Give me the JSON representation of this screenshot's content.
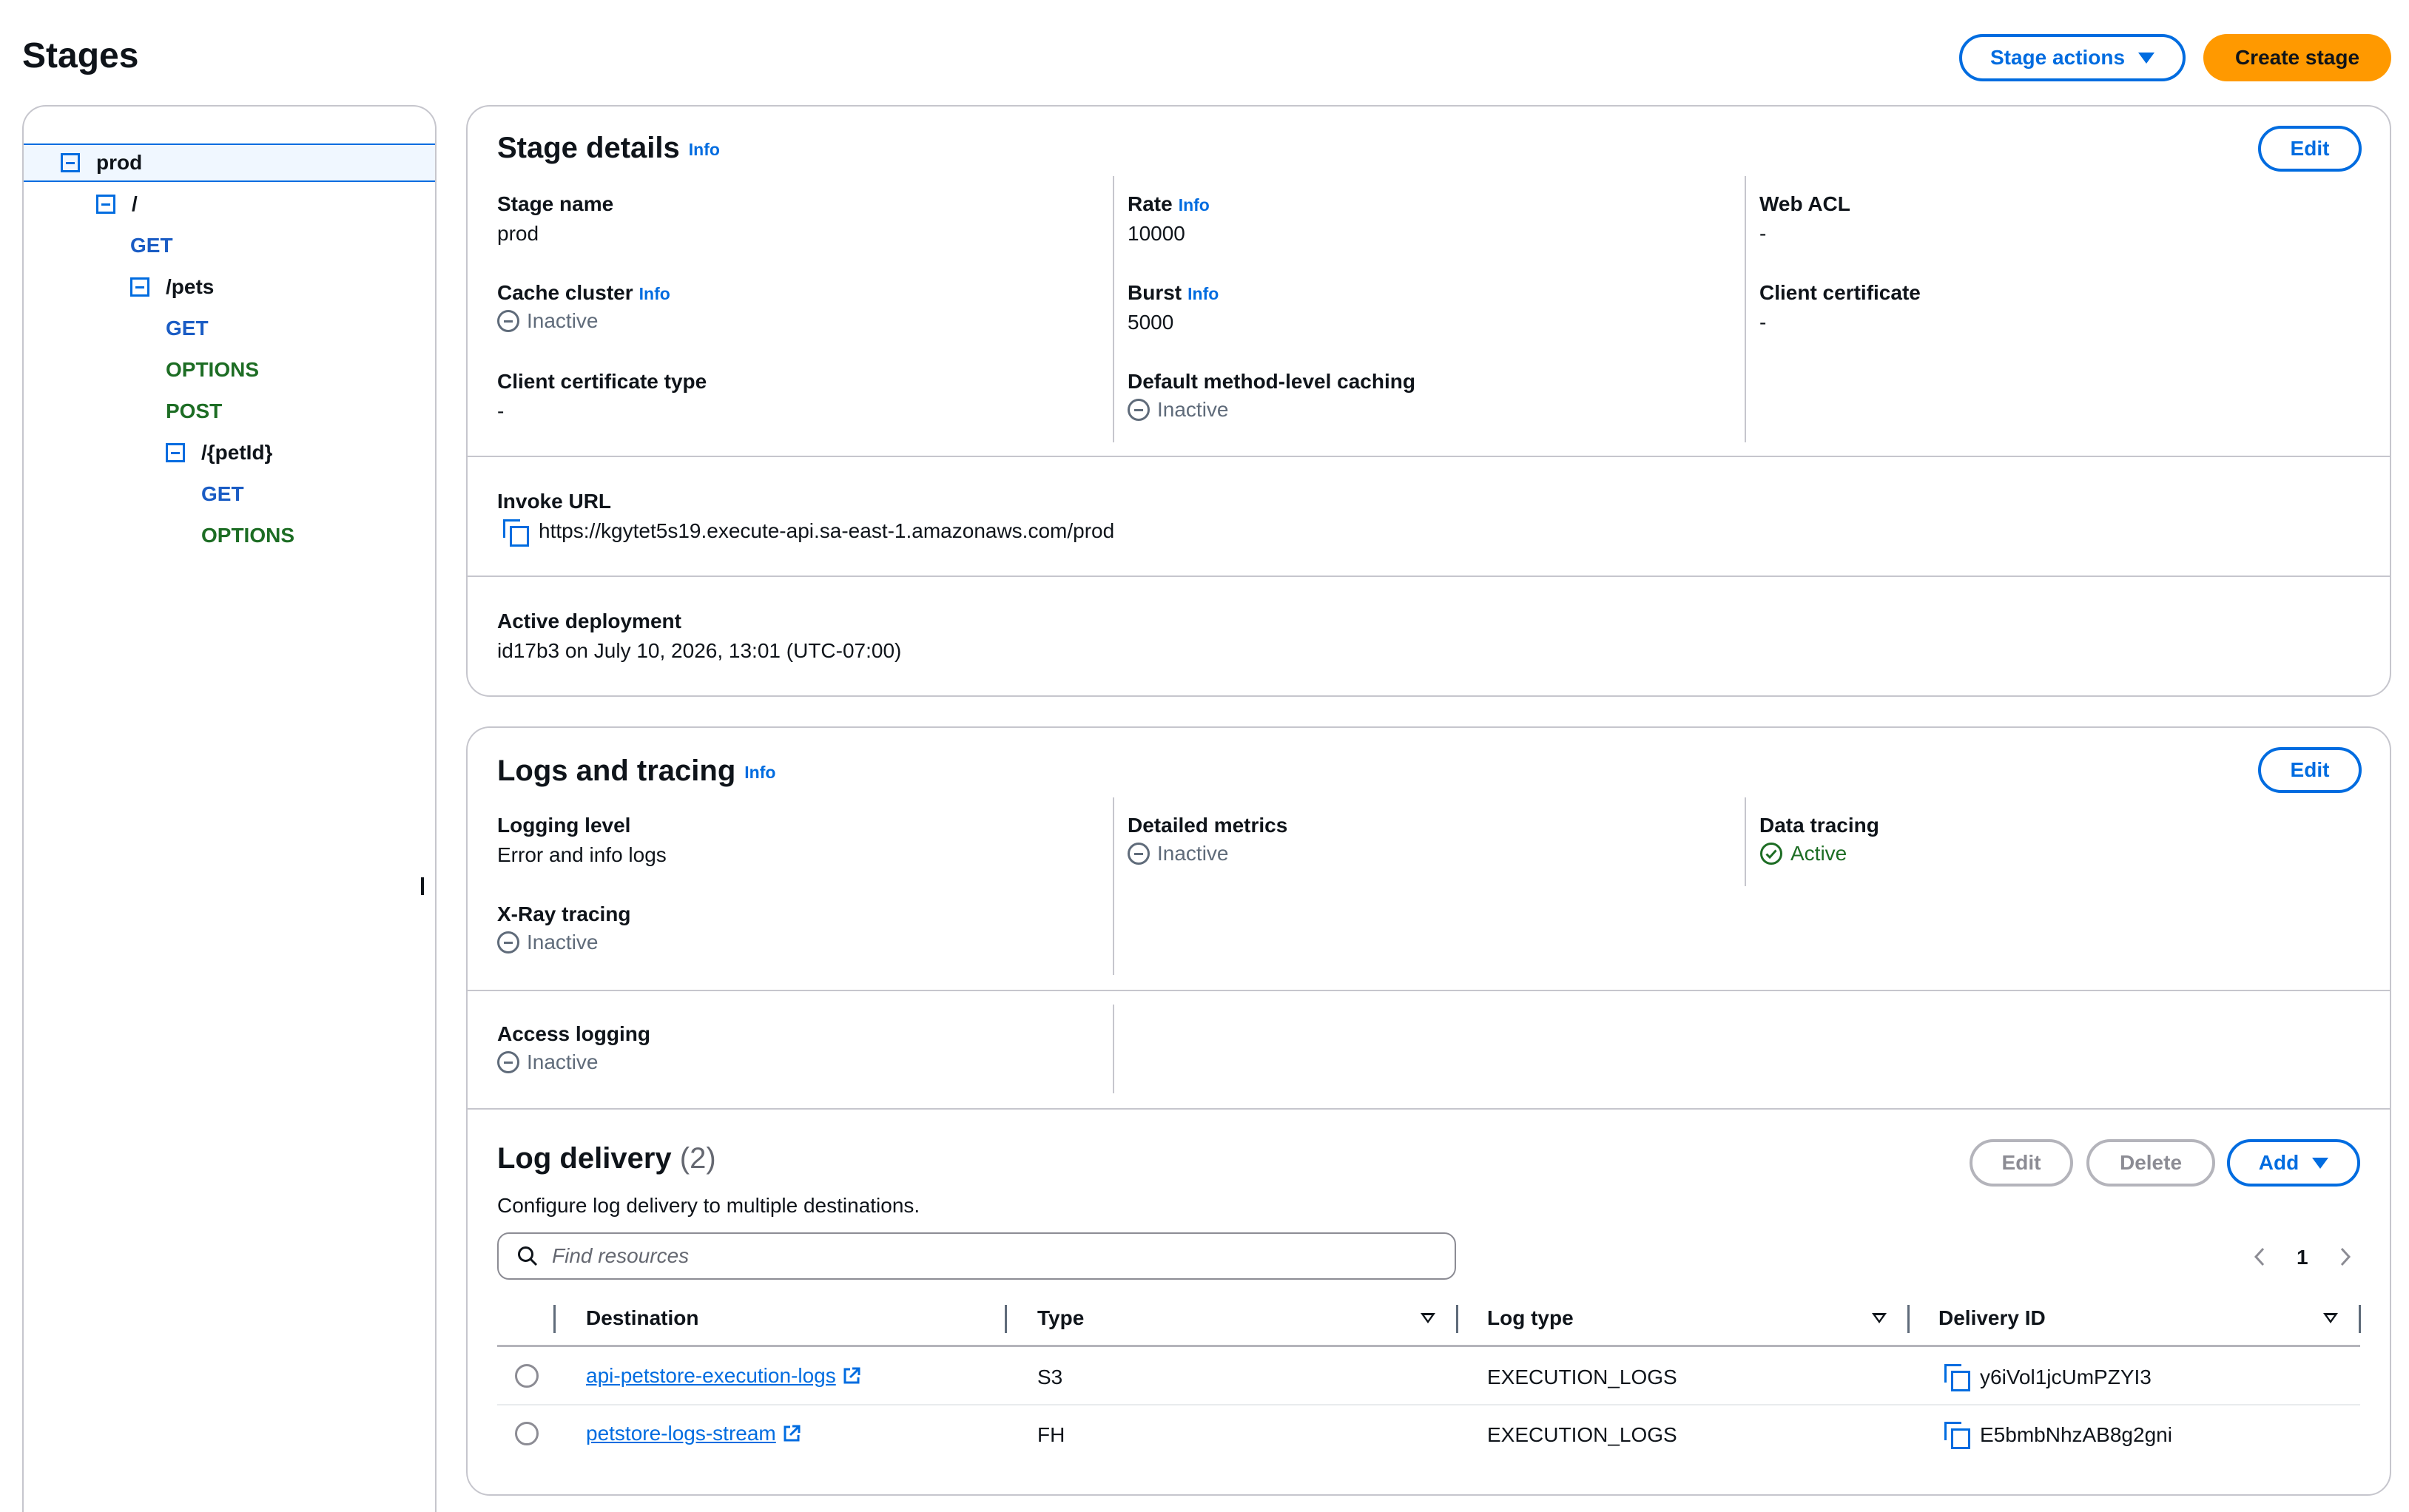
{
  "header": {
    "title": "Stages",
    "stage_actions_label": "Stage actions",
    "create_stage_label": "Create stage"
  },
  "tree": {
    "root": "prod",
    "resource_root": "/",
    "root_methods": [
      "GET"
    ],
    "pets": "/pets",
    "pets_methods": [
      "GET",
      "OPTIONS",
      "POST"
    ],
    "pet_id": "/{petId}",
    "pet_id_methods": [
      "GET",
      "OPTIONS"
    ]
  },
  "stage_details": {
    "title": "Stage details",
    "info": "Info",
    "edit_label": "Edit",
    "stage_name_label": "Stage name",
    "stage_name": "prod",
    "rate_label": "Rate",
    "rate": "10000",
    "web_acl_label": "Web ACL",
    "web_acl": "-",
    "cache_cluster_label": "Cache cluster",
    "cache_cluster": "Inactive",
    "burst_label": "Burst",
    "burst": "5000",
    "client_certificate_label": "Client certificate",
    "client_certificate": "-",
    "client_certificate_type_label": "Client certificate type",
    "client_certificate_type": "-",
    "default_caching_label": "Default method-level caching",
    "default_caching": "Inactive",
    "invoke_url_label": "Invoke URL",
    "invoke_url": "https://kgytet5s19.execute-api.sa-east-1.amazonaws.com/prod",
    "active_deployment_label": "Active deployment",
    "active_deployment": "id17b3 on July 10, 2026, 13:01 (UTC-07:00)"
  },
  "logs": {
    "title": "Logs and tracing",
    "info": "Info",
    "edit_label": "Edit",
    "logging_level_label": "Logging level",
    "logging_level": "Error and info logs",
    "detailed_metrics_label": "Detailed metrics",
    "detailed_metrics": "Inactive",
    "data_tracing_label": "Data tracing",
    "data_tracing": "Active",
    "xray_label": "X-Ray tracing",
    "xray": "Inactive",
    "access_logging_label": "Access logging",
    "access_logging": "Inactive"
  },
  "log_delivery": {
    "title": "Log delivery",
    "count": "(2)",
    "description": "Configure log delivery to multiple destinations.",
    "edit_label": "Edit",
    "delete_label": "Delete",
    "add_label": "Add",
    "search_placeholder": "Find resources",
    "page": "1",
    "columns": [
      "Destination",
      "Type",
      "Log type",
      "Delivery ID"
    ],
    "rows": [
      {
        "destination": "api-petstore-execution-logs",
        "type": "S3",
        "log_type": "EXECUTION_LOGS",
        "delivery_id": "y6iVol1jcUmPZYI3"
      },
      {
        "destination": "petstore-logs-stream",
        "type": "FH",
        "log_type": "EXECUTION_LOGS",
        "delivery_id": "E5bmbNhzAB8g2gni"
      }
    ]
  },
  "colors": {
    "accent": "#006ce0",
    "primary_button": "#ff9900",
    "active_status": "#1d6d24"
  }
}
